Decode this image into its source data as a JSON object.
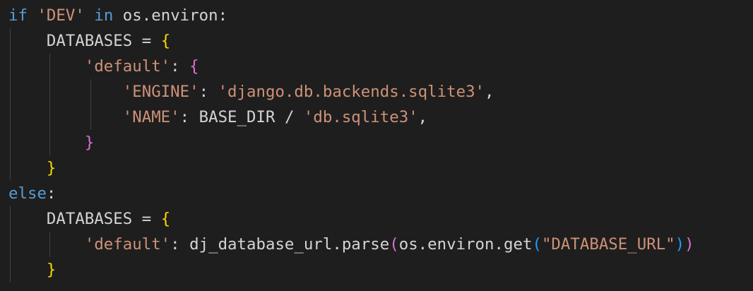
{
  "code": {
    "l1": {
      "if": "if",
      "sp1": " ",
      "dev": "'DEV'",
      "sp2": " ",
      "in": "in",
      "rest": " os.environ:"
    },
    "l2": {
      "indent": "    ",
      "text": "DATABASES = ",
      "brace": "{"
    },
    "l3": {
      "indent": "        ",
      "key": "'default'",
      "colon": ": ",
      "brace": "{"
    },
    "l4": {
      "indent": "            ",
      "key": "'ENGINE'",
      "colon": ": ",
      "val": "'django.db.backends.sqlite3'",
      "comma": ","
    },
    "l5": {
      "indent": "            ",
      "key": "'NAME'",
      "mid": ": BASE_DIR / ",
      "val": "'db.sqlite3'",
      "comma": ","
    },
    "l6": {
      "indent": "        ",
      "brace": "}"
    },
    "l7": {
      "indent": "    ",
      "brace": "}"
    },
    "l8": {
      "else": "else",
      "colon": ":"
    },
    "l9": {
      "indent": "    ",
      "text": "DATABASES = ",
      "brace": "{"
    },
    "l10": {
      "indent": "        ",
      "key": "'default'",
      "mid": ": dj_database_url.parse",
      "p1": "(",
      "mid2": "os.environ.get",
      "p2": "(",
      "val": "\"DATABASE_URL\"",
      "p3": ")",
      "p4": ")"
    },
    "l11": {
      "indent": "    ",
      "brace": "}"
    }
  },
  "colors": {
    "background": "#1e1e1e",
    "keyword": "#569cd6",
    "string": "#ce9178",
    "text": "#d4d4d4",
    "bracket1": "#ffd700",
    "bracket2": "#da70d6",
    "bracket3": "#179fff"
  }
}
